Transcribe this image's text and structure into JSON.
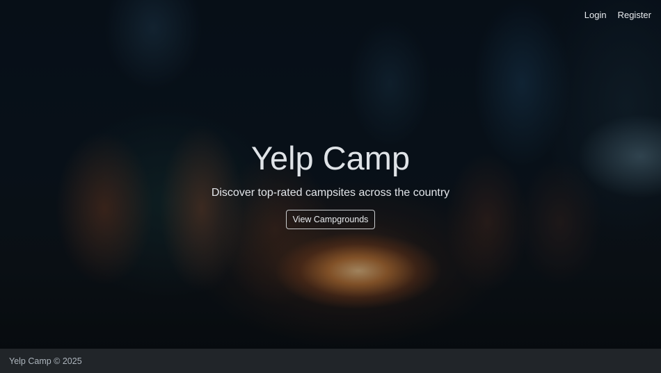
{
  "nav": {
    "login_label": "Login",
    "register_label": "Register"
  },
  "hero": {
    "title": "Yelp Camp",
    "subtitle": "Discover top-rated campsites across the country",
    "button_label": "View Campgrounds"
  },
  "footer": {
    "text": "Yelp Camp © 2025"
  },
  "colors": {
    "footer_bg": "#212529",
    "text_light": "#e9ecef",
    "footer_text": "#adb5bd"
  }
}
